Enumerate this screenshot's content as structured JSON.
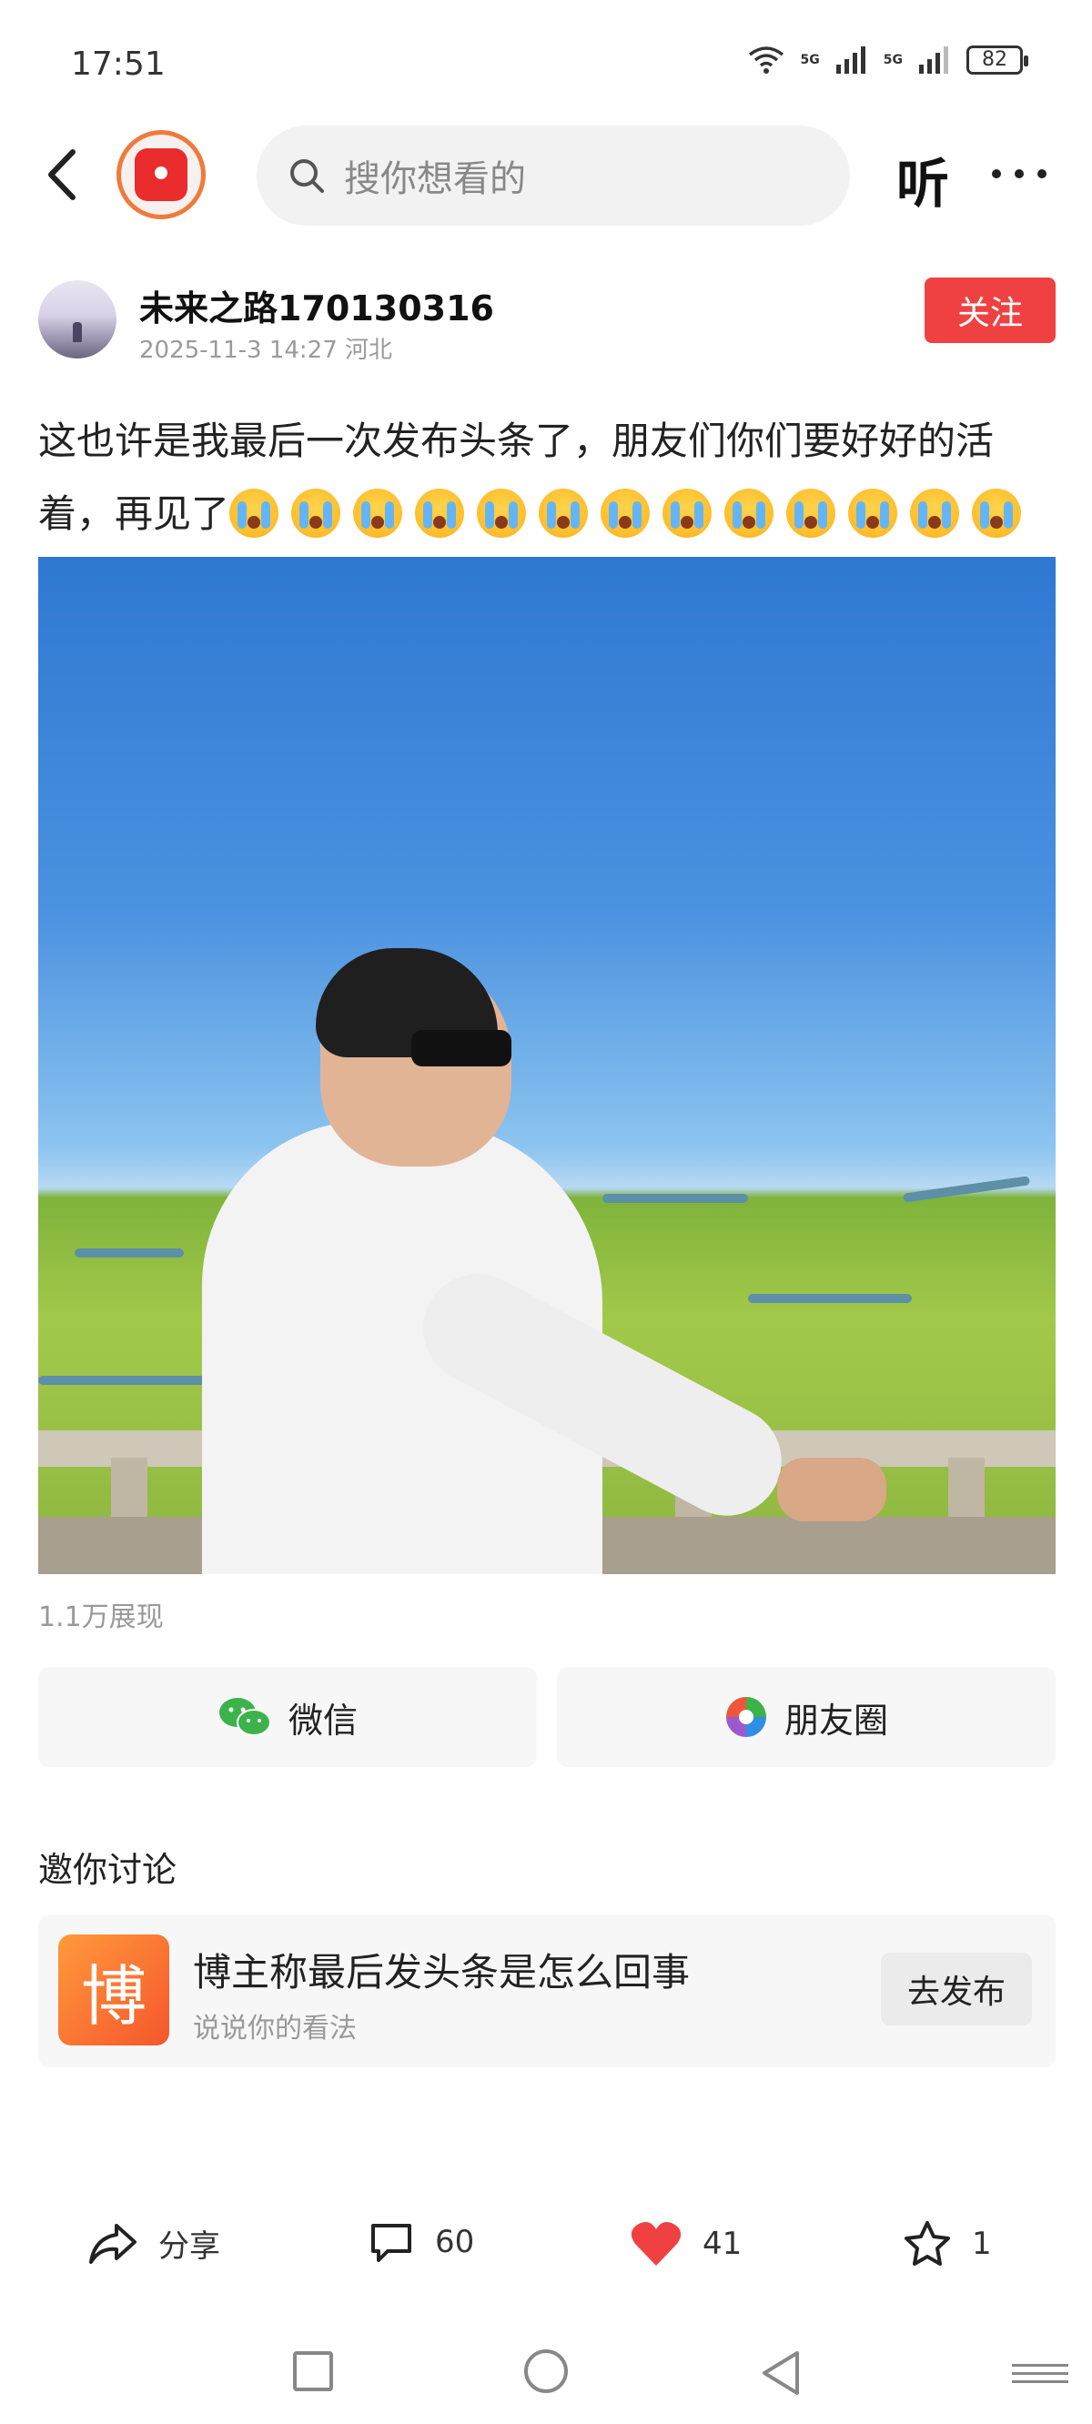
{
  "status_bar": {
    "time": "17:51",
    "network_1": "5G",
    "network_2": "5G",
    "battery": "82"
  },
  "nav": {
    "search_placeholder": "搜你想看的",
    "listen_label": "听"
  },
  "author": {
    "name": "未来之路170130316",
    "meta": "2025-11-3 14:27 河北",
    "follow_label": "关注"
  },
  "post": {
    "text": "这也许是我最后一次发布头条了，朋友们你们要好好的活着，再见了",
    "emoji_count": 13,
    "emoji_name": "loudly-crying-face",
    "views": "1.1万展现"
  },
  "share": {
    "wechat_label": "微信",
    "moments_label": "朋友圈"
  },
  "discussion": {
    "section_title": "邀你讨论",
    "badge_char": "博",
    "topic_title": "博主称最后发头条是怎么回事",
    "topic_sub": "说说你的看法",
    "publish_label": "去发布"
  },
  "actions": {
    "share_label": "分享",
    "comments": "60",
    "likes": "41",
    "favorites": "1",
    "like_color": "#f04142"
  },
  "colors": {
    "accent": "#f04142",
    "wechat_green": "#3cb34a"
  }
}
